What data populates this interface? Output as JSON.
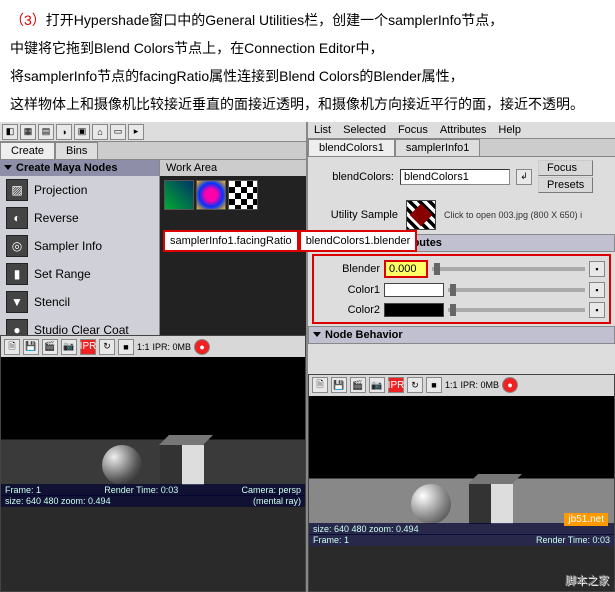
{
  "desc": {
    "step": "（3）",
    "line1a": "打开Hypershade窗口中的General Utilities栏，创建一个samplerInfo节点，",
    "line2": "中键将它拖到Blend Colors节点上，在Connection Editor中，",
    "line3": "将samplerInfo节点的facingRatio属性连接到Blend Colors的Blender属性，",
    "line4": "这样物体上和摄像机比较接近垂直的面接近透明，和摄像机方向接近平行的面，接近不透明。"
  },
  "hypershade": {
    "tabs": [
      "Create",
      "Bins"
    ],
    "workarea_label": "Work Area",
    "nodes_header": "Create Maya Nodes",
    "nodes": [
      "Projection",
      "Reverse",
      "Sampler Info",
      "Set Range",
      "Stencil",
      "Studio Clear Coat"
    ],
    "annot_left": "samplerInfo1.facingRatio",
    "annot_right": "blendColors1.blender"
  },
  "ae": {
    "menus": [
      "List",
      "Selected",
      "Focus",
      "Attributes",
      "Help"
    ],
    "tabs": [
      "blendColors1",
      "samplerInfo1"
    ],
    "name_lbl": "blendColors:",
    "name_val": "blendColors1",
    "focus_btn": "Focus",
    "presets_btn": "Presets",
    "util_lbl": "Utility Sample",
    "thumb_note": "Click to open 003.jpg (800 X 650) i",
    "section1": "Blend Color Attributes",
    "blender_lbl": "Blender",
    "blender_val": "0.000",
    "color1_lbl": "Color1",
    "color2_lbl": "Color2",
    "section2": "Node Behavior"
  },
  "render": {
    "ratio": "1:1",
    "ipr": "IPR: 0MB",
    "ipr_label": "IPR",
    "status_left_l": "size: 640  480 zoom: 0.494",
    "status_left_r": "(mental ray)",
    "status_left_b1": "Frame: 1",
    "status_left_b2": "Render Time: 0:03",
    "status_left_b3": "Camera: persp",
    "status_right_l": "size: 640  480 zoom: 0.494",
    "status_right_b1": "Frame: 1",
    "status_right_b2": "Render Time: 0:03"
  },
  "wm1": "jb51.net",
  "wm2": "脚本之家"
}
